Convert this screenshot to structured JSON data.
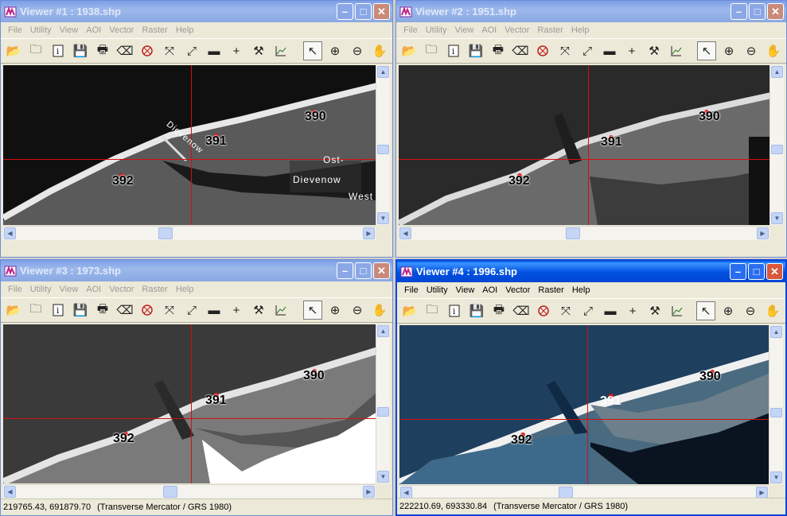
{
  "menus": [
    "File",
    "Utility",
    "View",
    "AOI",
    "Vector",
    "Raster",
    "Help"
  ],
  "viewers": [
    {
      "title": "Viewer #1 : 1938.shp",
      "active": false,
      "labels": {
        "a": "390",
        "b": "391",
        "c": "392"
      },
      "place": [
        "Dievenow",
        "Ost-",
        "Dievenow",
        "West"
      ]
    },
    {
      "title": "Viewer #2 : 1951.shp",
      "active": false,
      "labels": {
        "a": "390",
        "b": "391",
        "c": "392"
      }
    },
    {
      "title": "Viewer #3 : 1973.shp",
      "active": false,
      "labels": {
        "a": "390",
        "b": "391",
        "c": "392"
      },
      "status": {
        "coords": "219765.43, 691879.70",
        "projection": "(Transverse Mercator / GRS 1980)"
      }
    },
    {
      "title": "Viewer #4 : 1996.shp",
      "active": true,
      "labels": {
        "a": "390",
        "b": "391",
        "c": "392"
      },
      "status": {
        "coords": "222210.69, 693330.84",
        "projection": "(Transverse Mercator / GRS 1980)"
      }
    }
  ],
  "icons": [
    "open-folder",
    "new-layer",
    "info",
    "save",
    "print",
    "eraser",
    "grid",
    "shrink",
    "expand",
    "measure",
    "crosshair",
    "hammer",
    "chart",
    "pointer",
    "zoom-in",
    "zoom-out",
    "pan-hand"
  ],
  "colors": {
    "crosshair": "#d41010",
    "active_title": "#0050e0",
    "inactive_title": "#8aa8e3"
  }
}
